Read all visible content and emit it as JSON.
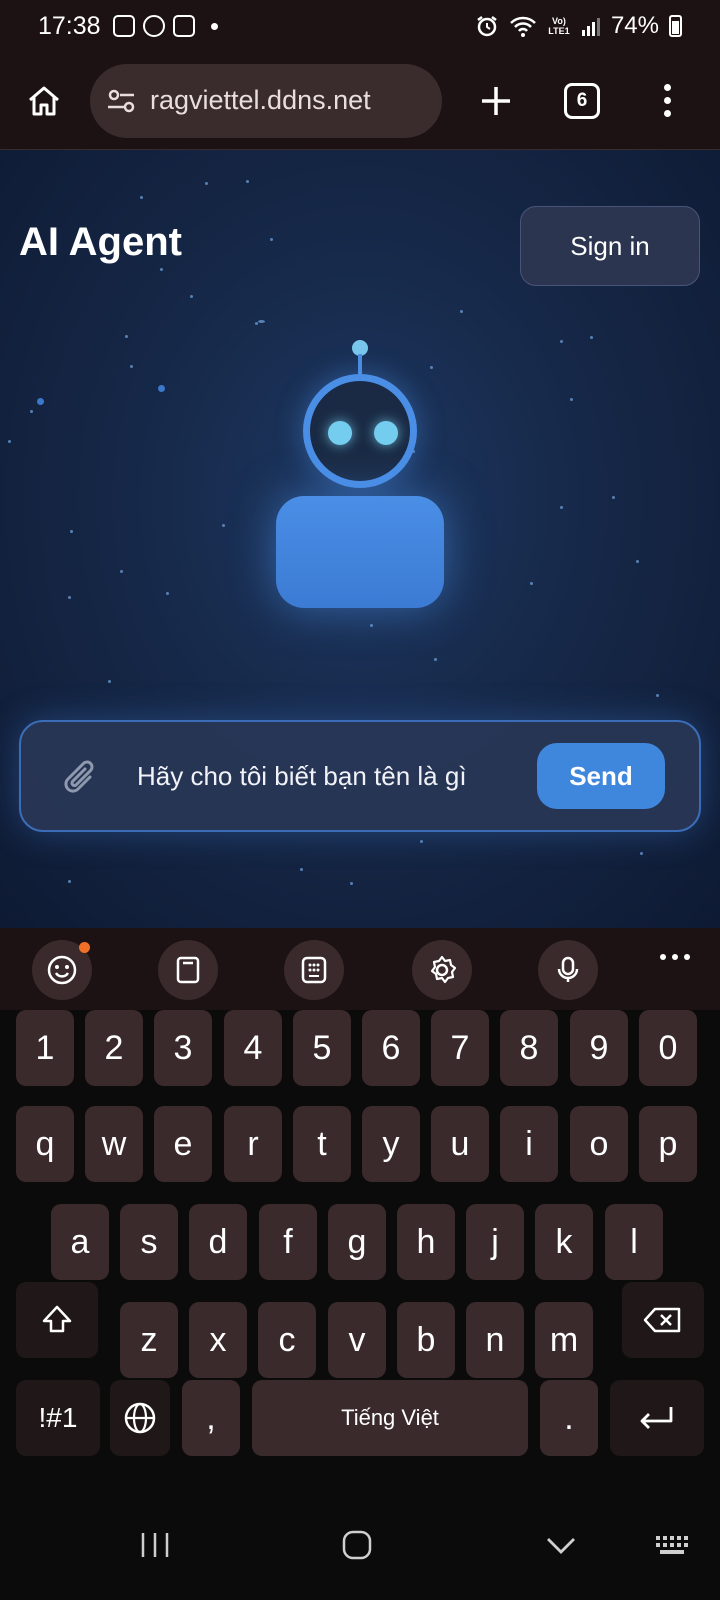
{
  "status_bar": {
    "time": "17:38",
    "battery": "74%",
    "icons": [
      "gallery-icon",
      "messenger-icon",
      "video-icon",
      "alarm-icon",
      "wifi-icon",
      "volte-icon",
      "signal-icon",
      "battery-icon"
    ],
    "network_label": "Vo) LTE1"
  },
  "browser": {
    "url": "ragviettel.ddns.net",
    "tab_count": "6"
  },
  "page": {
    "brand": "AI Agent",
    "signin_label": "Sign in",
    "chat": {
      "input_value": "Hãy cho tôi biết bạn tên là gì",
      "send_label": "Send"
    },
    "colors": {
      "accent": "#3f86dd",
      "background": "#162848"
    }
  },
  "keyboard": {
    "toolbar": [
      "emoji-icon",
      "clipboard-icon",
      "keypad-icon",
      "settings-icon",
      "mic-icon",
      "more-icon"
    ],
    "rows": [
      [
        "1",
        "2",
        "3",
        "4",
        "5",
        "6",
        "7",
        "8",
        "9",
        "0"
      ],
      [
        "q",
        "w",
        "e",
        "r",
        "t",
        "y",
        "u",
        "i",
        "o",
        "p"
      ],
      [
        "a",
        "s",
        "d",
        "f",
        "g",
        "h",
        "j",
        "k",
        "l"
      ],
      [
        "z",
        "x",
        "c",
        "v",
        "b",
        "n",
        "m"
      ]
    ],
    "symbols_label": "!#1",
    "comma_label": ",",
    "space_label": "Tiếng Việt",
    "period_label": "."
  }
}
